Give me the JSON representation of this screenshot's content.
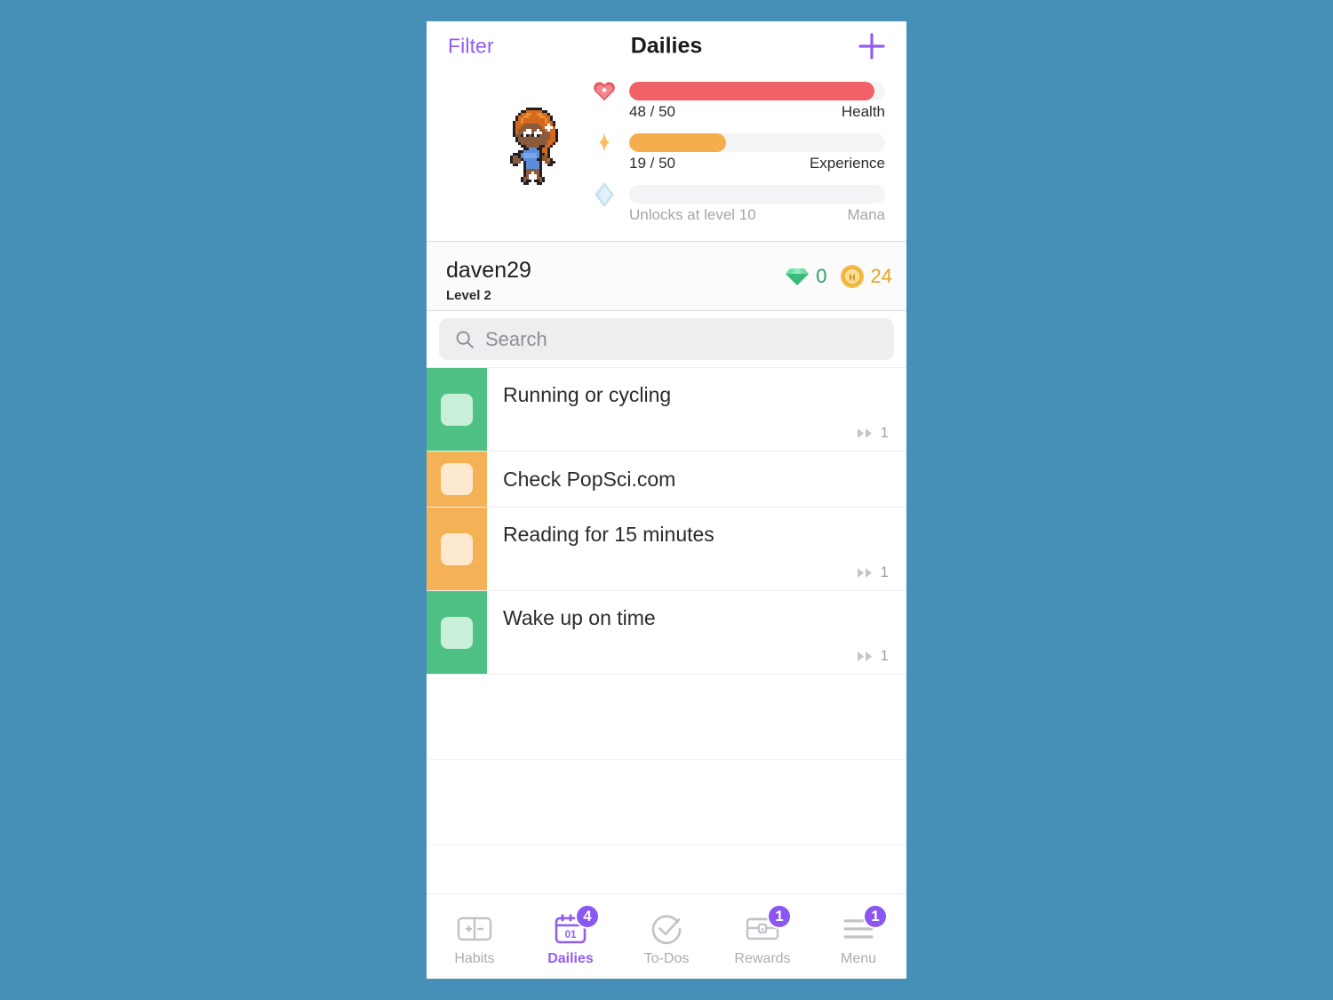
{
  "colors": {
    "background": "#4690b8",
    "accent_purple": "#925cf3",
    "health_red": "#f06168",
    "experience_orange": "#f5ae4d",
    "mana_blue": "#bcdcf0",
    "task_green": "#4fc185",
    "task_orange": "#f5b155",
    "gem_green": "#2e9e62",
    "gold_yellow": "#e6a31d"
  },
  "navbar": {
    "filter_label": "Filter",
    "title": "Dailies",
    "add_icon": "plus-icon"
  },
  "stats": {
    "avatar_icon": "avatar-sprite",
    "bars": [
      {
        "key": "health",
        "icon": "heart-icon",
        "value_text": "48 / 50",
        "label": "Health",
        "percent": 96
      },
      {
        "key": "experience",
        "icon": "star-icon",
        "value_text": "19 / 50",
        "label": "Experience",
        "percent": 38
      },
      {
        "key": "mana",
        "icon": "diamond-icon",
        "value_text": "Unlocks at level 10",
        "label": "Mana",
        "percent": 0
      }
    ]
  },
  "user": {
    "name": "daven29",
    "level": "Level 2",
    "gems": {
      "icon": "gem-icon",
      "value": "0"
    },
    "gold": {
      "icon": "gold-coin-icon",
      "value": "24"
    }
  },
  "search": {
    "icon": "search-icon",
    "placeholder": "Search",
    "value": ""
  },
  "tasks": [
    {
      "title": "Running or cycling",
      "color": "#4fc185",
      "checkbox_color": "#c9efd9",
      "streak_icon": "fast-forward-icon",
      "streak": "1",
      "has_streak": true
    },
    {
      "title": "Check PopSci.com",
      "color": "#f5b155",
      "checkbox_color": "#fce9cf",
      "streak_icon": "fast-forward-icon",
      "streak": "",
      "has_streak": false
    },
    {
      "title": "Reading for 15 minutes",
      "color": "#f5b155",
      "checkbox_color": "#fce9cf",
      "streak_icon": "fast-forward-icon",
      "streak": "1",
      "has_streak": true
    },
    {
      "title": "Wake up on time",
      "color": "#4fc185",
      "checkbox_color": "#c9efd9",
      "streak_icon": "fast-forward-icon",
      "streak": "1",
      "has_streak": true
    }
  ],
  "tabbar": [
    {
      "label": "Habits",
      "icon": "habits-plusminus-icon",
      "badge": "",
      "active": false
    },
    {
      "label": "Dailies",
      "icon": "calendar-01-icon",
      "badge": "4",
      "active": true
    },
    {
      "label": "To-Dos",
      "icon": "check-circle-icon",
      "badge": "",
      "active": false
    },
    {
      "label": "Rewards",
      "icon": "treasure-chest-icon",
      "badge": "1",
      "active": false
    },
    {
      "label": "Menu",
      "icon": "hamburger-menu-icon",
      "badge": "1",
      "active": false
    }
  ]
}
